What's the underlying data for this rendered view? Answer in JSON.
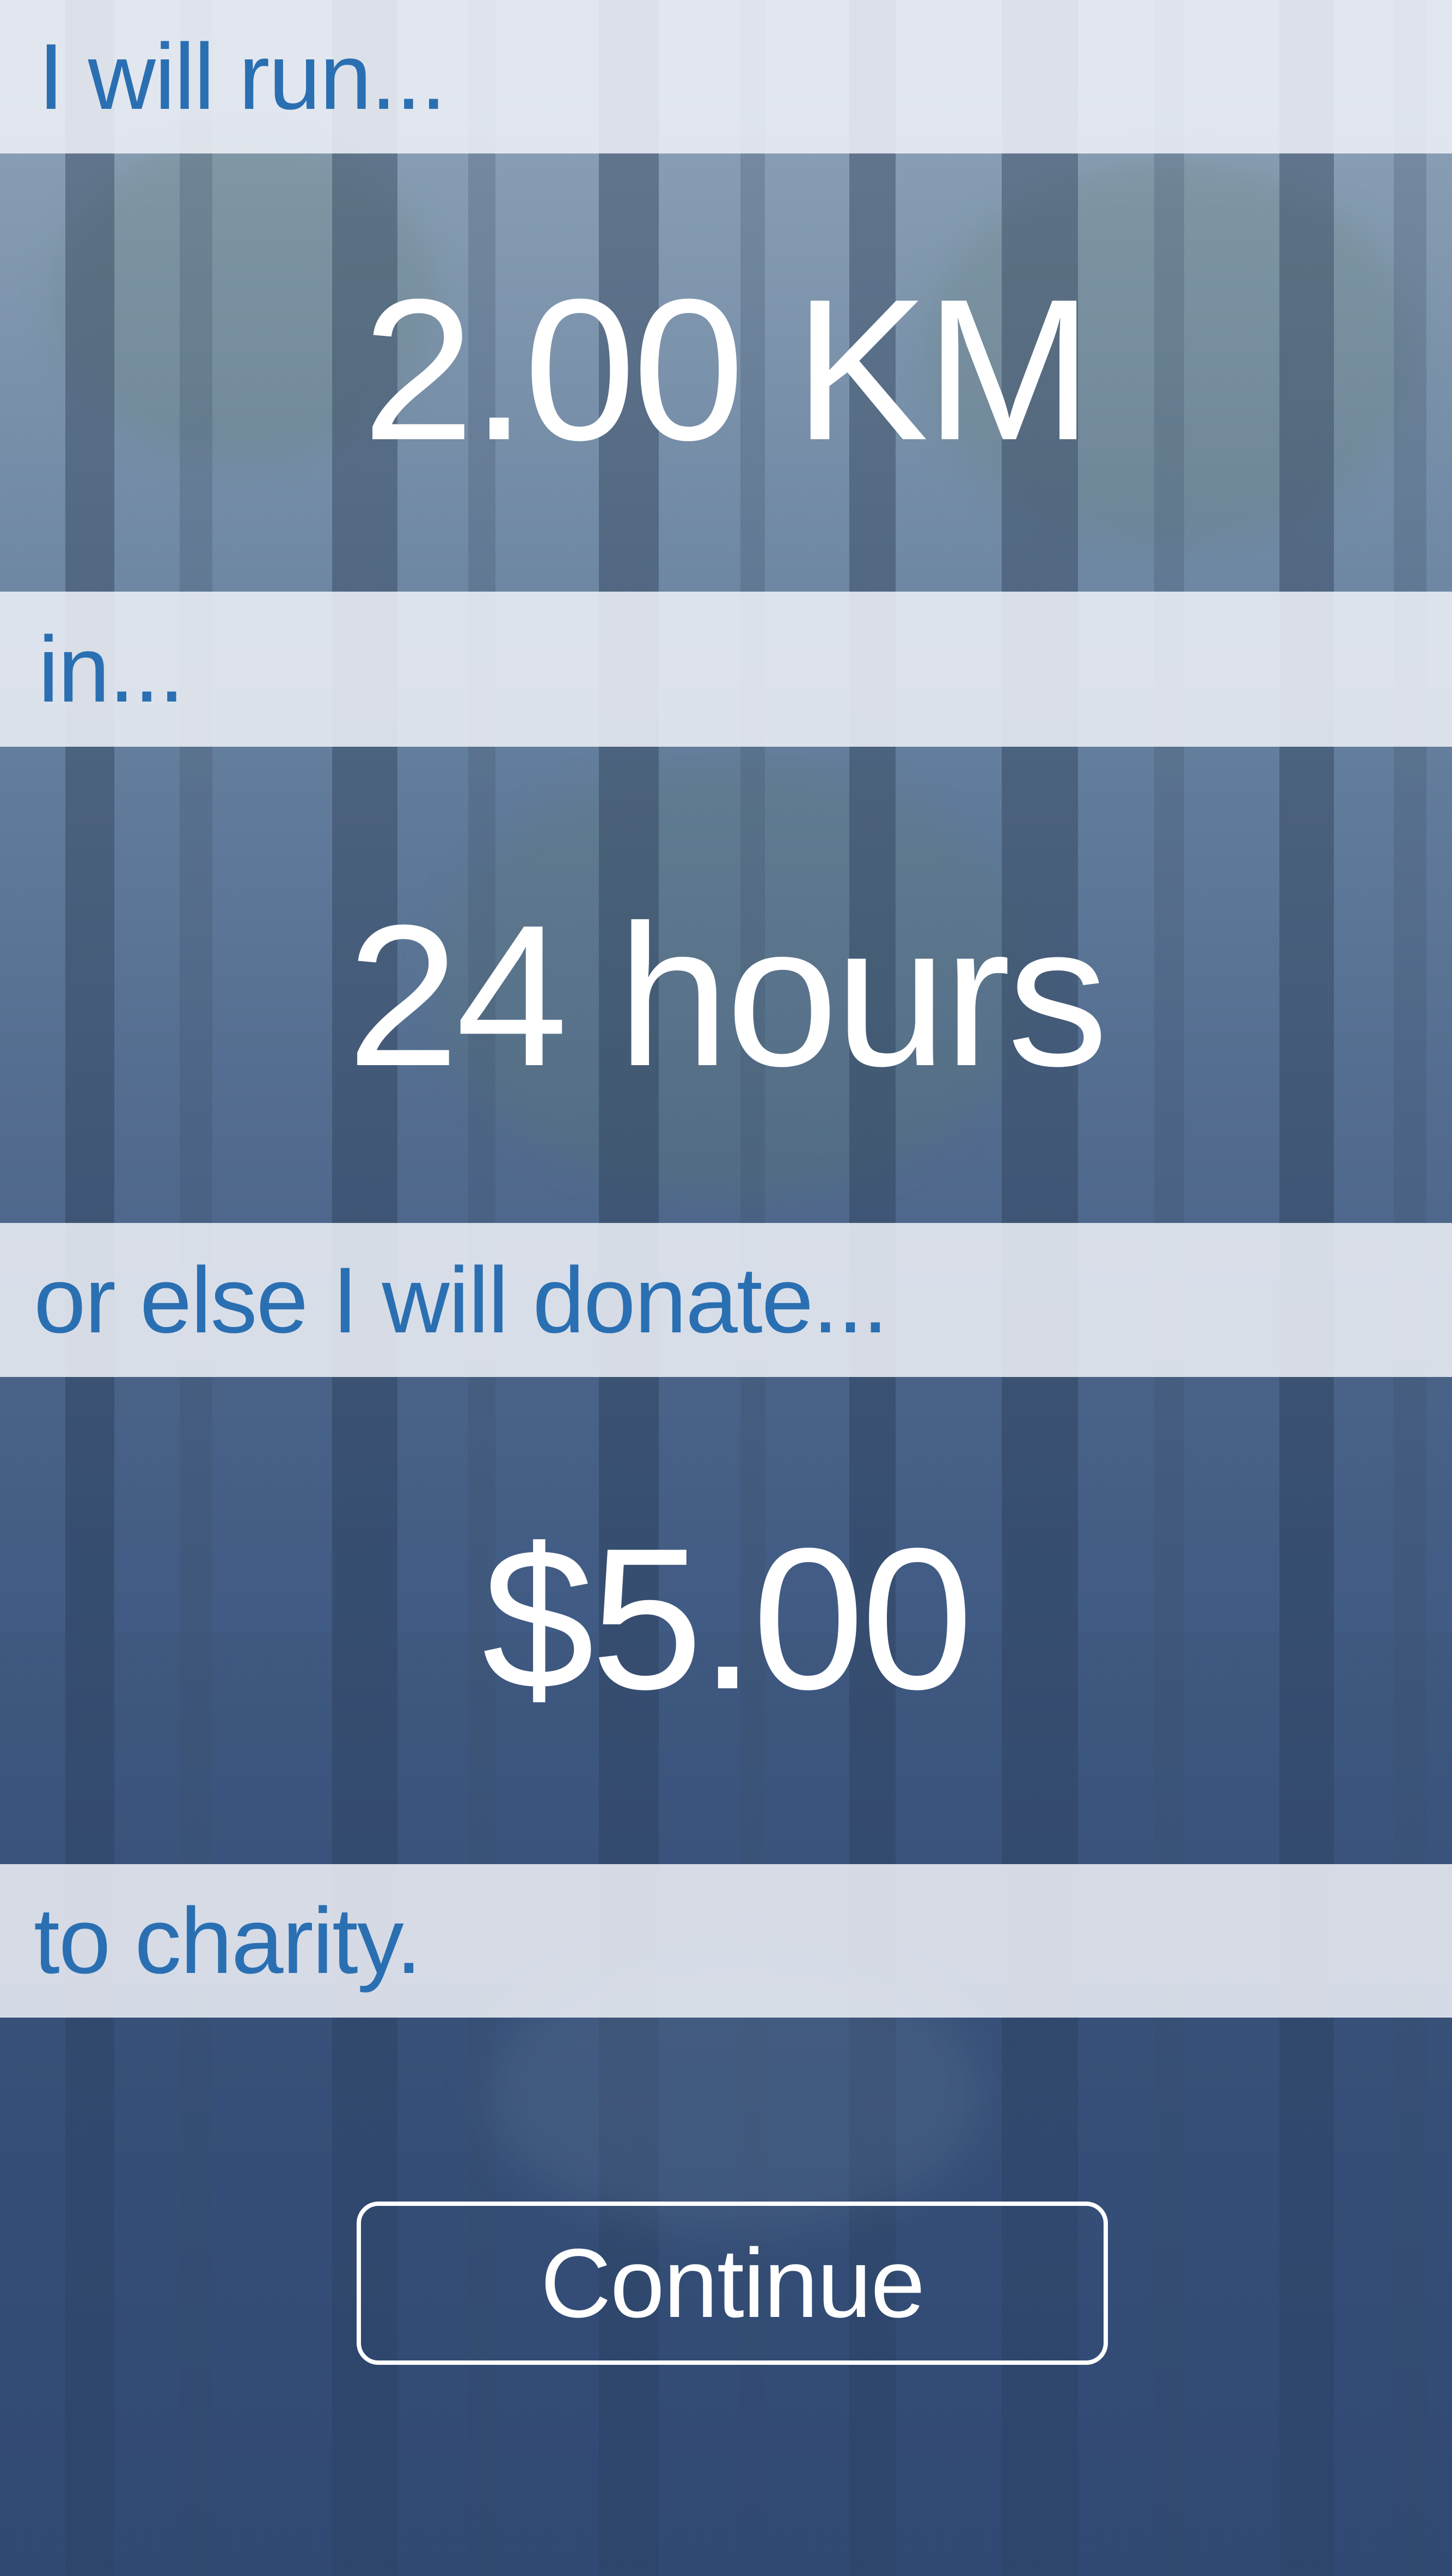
{
  "intro": {
    "run_label": "I will run...",
    "time_label": "in...",
    "donate_label": "or else I will donate...",
    "charity_label": "to charity."
  },
  "goal": {
    "distance": "2.00 KM",
    "duration": "24 hours",
    "donation": "$5.00"
  },
  "actions": {
    "continue_label": "Continue"
  },
  "colors": {
    "label_text": "#2a6fb2",
    "value_text": "#ffffff",
    "band_background": "#f0f2f8"
  }
}
